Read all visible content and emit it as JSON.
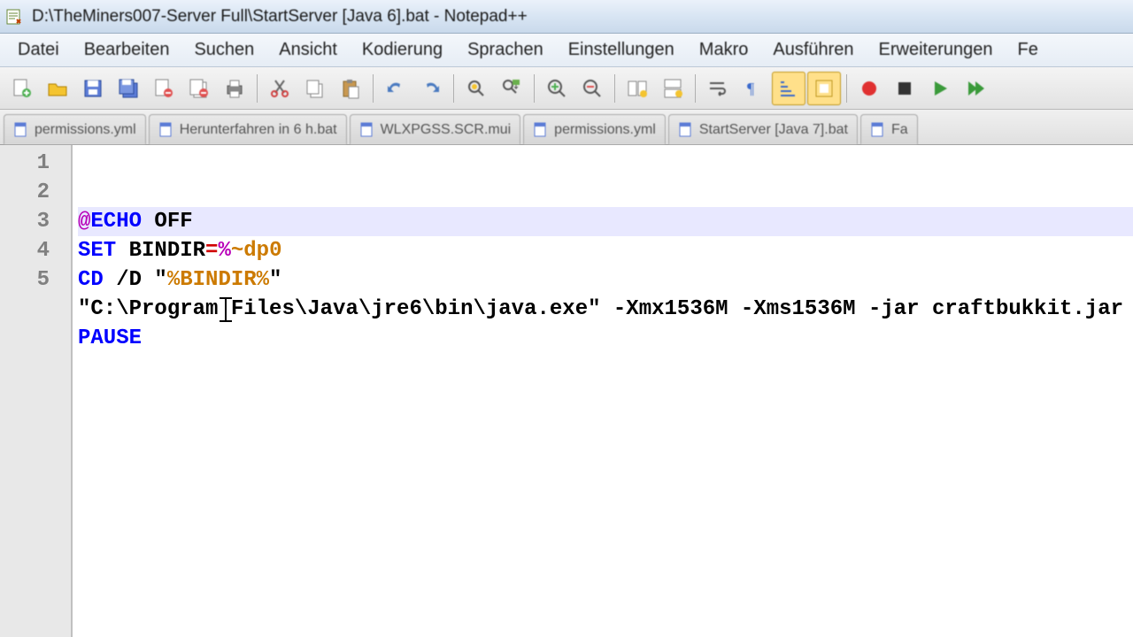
{
  "window": {
    "title": "D:\\TheMiners007-Server Full\\StartServer [Java 6].bat - Notepad++"
  },
  "menu": {
    "items": [
      "Datei",
      "Bearbeiten",
      "Suchen",
      "Ansicht",
      "Kodierung",
      "Sprachen",
      "Einstellungen",
      "Makro",
      "Ausführen",
      "Erweiterungen",
      "Fe"
    ]
  },
  "toolbar_icons": [
    "new-file",
    "open-file",
    "save",
    "save-all",
    "close",
    "close-all",
    "print",
    "cut",
    "copy",
    "paste",
    "undo",
    "redo",
    "find",
    "replace",
    "zoom-in",
    "zoom-out",
    "sync-v",
    "sync-h",
    "word-wrap",
    "show-chars",
    "indent-guide",
    "ext1",
    "record-macro",
    "stop-macro",
    "play-macro",
    "play-multi"
  ],
  "tabs": [
    {
      "label": "permissions.yml"
    },
    {
      "label": "Herunterfahren in 6 h.bat"
    },
    {
      "label": "WLXPGSS.SCR.mui"
    },
    {
      "label": "permissions.yml"
    },
    {
      "label": "StartServer [Java 7].bat"
    },
    {
      "label": "Fa"
    }
  ],
  "code": {
    "lines": [
      {
        "n": 1,
        "tokens": [
          {
            "t": "@",
            "c": "at"
          },
          {
            "t": "ECHO",
            "c": "kw"
          },
          {
            "t": " OFF",
            "c": "txt"
          }
        ]
      },
      {
        "n": 2,
        "tokens": [
          {
            "t": "SET",
            "c": "kw"
          },
          {
            "t": " BINDIR",
            "c": "txt"
          },
          {
            "t": "=",
            "c": "op"
          },
          {
            "t": "%",
            "c": "at"
          },
          {
            "t": "~dp0",
            "c": "var2"
          }
        ]
      },
      {
        "n": 3,
        "tokens": [
          {
            "t": "CD",
            "c": "kw"
          },
          {
            "t": " /D \"",
            "c": "txt"
          },
          {
            "t": "%BINDIR%",
            "c": "var2"
          },
          {
            "t": "\"",
            "c": "txt"
          }
        ]
      },
      {
        "n": 4,
        "tokens": [
          {
            "t": "\"C:\\Program Files\\Java\\jre6\\bin\\java.exe\" -Xmx1536M -Xms1536M -jar craftbukkit.jar",
            "c": "txt"
          }
        ]
      },
      {
        "n": 5,
        "tokens": [
          {
            "t": "PAUSE",
            "c": "kw"
          }
        ]
      }
    ]
  }
}
